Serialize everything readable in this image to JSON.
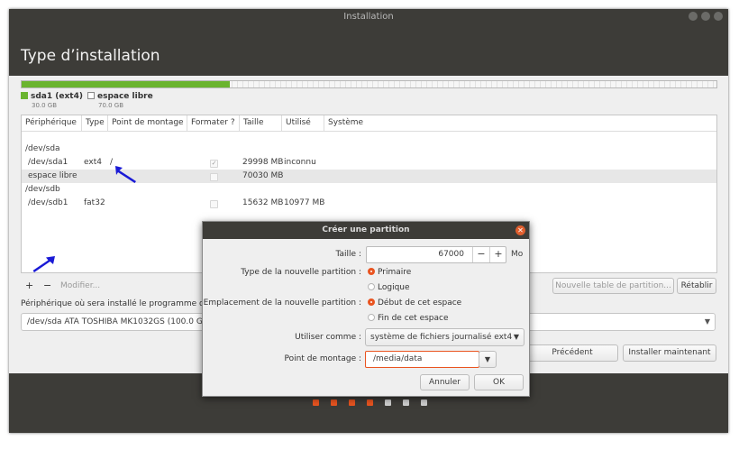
{
  "window": {
    "title": "Installation"
  },
  "page": {
    "title": "Type d’installation"
  },
  "disk_bar": {
    "used_fraction": 0.3
  },
  "legend": [
    {
      "name": "sda1 (ext4)",
      "size": "30.0 GB",
      "color": "#6ab42f"
    },
    {
      "name": "espace libre",
      "size": "70.0 GB",
      "color": "#ffffff"
    }
  ],
  "table": {
    "headers": [
      "Périphérique",
      "Type",
      "Point de montage",
      "Formater ?",
      "Taille",
      "Utilisé",
      "Système"
    ],
    "rows": [
      {
        "device": "/dev/sda",
        "type": "",
        "mount": "",
        "format": null,
        "size": "",
        "used": "",
        "system": ""
      },
      {
        "device": "/dev/sda1",
        "type": "ext4",
        "mount": "/",
        "format": true,
        "size": "29998 MB",
        "used": "inconnu",
        "system": ""
      },
      {
        "device": "espace libre",
        "type": "",
        "mount": "",
        "format": false,
        "size": "70030 MB",
        "used": "",
        "system": "",
        "selected": true
      },
      {
        "device": "/dev/sdb",
        "type": "",
        "mount": "",
        "format": null,
        "size": "",
        "used": "",
        "system": ""
      },
      {
        "device": "/dev/sdb1",
        "type": "fat32",
        "mount": "",
        "format": false,
        "size": "15632 MB",
        "used": "10977 MB",
        "system": ""
      }
    ]
  },
  "controls": {
    "add": "+",
    "remove": "−",
    "modify": "Modifier...",
    "new_table": "Nouvelle table de partition...",
    "revert": "Rétablir"
  },
  "bootloader": {
    "label": "Périphérique où sera installé le programme de",
    "value": "/dev/sda   ATA TOSHIBA MK1032GS (100.0 G"
  },
  "nav": {
    "back": "Précédent",
    "install": "Installer maintenant"
  },
  "progress_dots": {
    "colors": [
      "#e95420",
      "#e95420",
      "#e95420",
      "#e95420",
      "#d0d0d0",
      "#d0d0d0",
      "#d0d0d0"
    ],
    "completed": 4,
    "total": 7
  },
  "dialog": {
    "title": "Créer une partition",
    "size_label": "Taille :",
    "size_value": "67000",
    "size_unit": "Mo",
    "minus": "−",
    "plus": "+",
    "type_label": "Type de la nouvelle partition :",
    "type_options": [
      "Primaire",
      "Logique"
    ],
    "type_selected": "Primaire",
    "location_label": "Emplacement de la nouvelle partition :",
    "location_options": [
      "Début de cet espace",
      "Fin de cet espace"
    ],
    "location_selected": "Début de cet espace",
    "use_as_label": "Utiliser comme :",
    "use_as_value": "système de fichiers journalisé ext4",
    "mount_label": "Point de montage :",
    "mount_value": "/media/data",
    "cancel": "Annuler",
    "ok": "OK"
  },
  "colors": {
    "accent": "#e95420",
    "used_partition": "#6ab42f",
    "annotation_arrow": "#1a1ad6",
    "chrome": "#3d3c38"
  }
}
